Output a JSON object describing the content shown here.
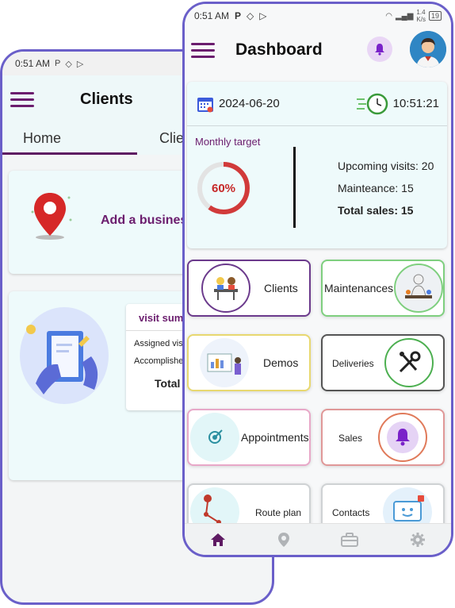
{
  "clients_screen": {
    "status_time": "0:51 AM",
    "title": "Clients",
    "tabs": [
      {
        "label": "Home"
      },
      {
        "label": "Clie"
      }
    ],
    "add_business_label": "Add a business",
    "summary": {
      "title": "visit summ",
      "assigned_label": "Assigned visit",
      "accomplished_label": "Accomplishe",
      "total_label": "Total v"
    }
  },
  "dashboard": {
    "status": {
      "time": "0:51 AM",
      "speed": "1.4",
      "speed_unit": "K/s",
      "battery": "19"
    },
    "title": "Dashboard",
    "date": "2024-06-20",
    "time": "10:51:21",
    "monthly_target": {
      "label": "Monthly target",
      "percent_label": "60%",
      "value": 0.6
    },
    "stats": {
      "upcoming_visits": "Upcoming visits: 20",
      "maintenance": "Mainteance: 15",
      "total_sales": "Total sales: 15"
    },
    "tiles": [
      {
        "label": "Clients",
        "border": "#6b3a8c"
      },
      {
        "label": "Maintenances",
        "border": "#7fcf7f"
      },
      {
        "label": "Demos",
        "border": "#e8d870"
      },
      {
        "label": "Deliveries",
        "border": "#555555"
      },
      {
        "label": "Appointments",
        "border": "#e8a8c8"
      },
      {
        "label": "Sales",
        "border": "#e09898"
      },
      {
        "label": "Route plan",
        "border": "#cfd2d4"
      },
      {
        "label": "Contacts",
        "border": "#cfd2d4"
      }
    ],
    "nav": [
      "home-icon",
      "location-icon",
      "briefcase-icon",
      "gear-icon"
    ]
  },
  "colors": {
    "brand": "#6b1d6e",
    "frame": "#6a5fc9",
    "gauge": "#d13a3a"
  }
}
